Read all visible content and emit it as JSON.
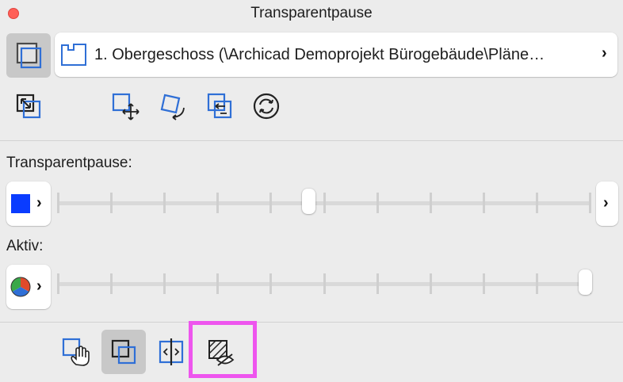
{
  "window": {
    "title": "Transparentpause"
  },
  "selector": {
    "text": "1. Obergeschoss (\\Archicad Demoprojekt Bürogebäude\\Pläne…"
  },
  "transparency": {
    "label": "Transparentpause:",
    "color": "#0a3cff",
    "level": 0.47,
    "ticks": 11
  },
  "active": {
    "label": "Aktiv:",
    "level": 1.0,
    "ticks": 11
  },
  "icons": {
    "layer": "overlay-layer-icon",
    "reference": "floor-reference-icon",
    "fit": "fit-to-view-icon",
    "move": "move-icon",
    "rotate": "rotate-icon",
    "mirror": "swap-icon",
    "reset": "reset-icon",
    "transparency_color": "color-swatch-icon",
    "active_color": "pie-color-icon",
    "hand": "hand-edit-icon",
    "reference_mode": "reference-overlay-icon",
    "compare": "compare-icon",
    "hide": "hatch-hide-icon"
  },
  "colors": {
    "accent": "#2f6fd6",
    "highlight": "#ee55ee"
  }
}
